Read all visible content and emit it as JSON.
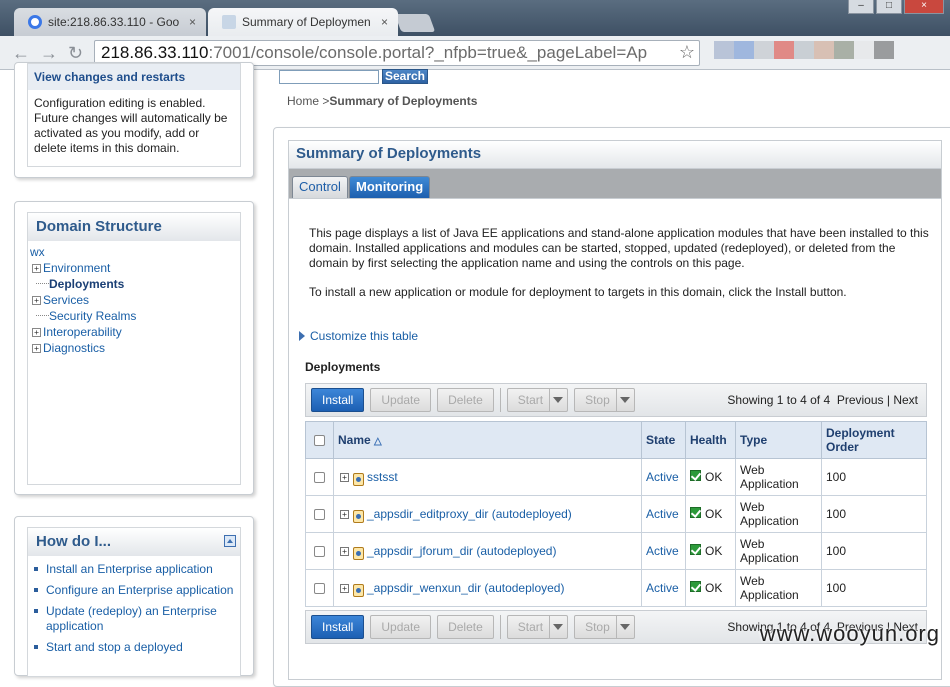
{
  "browser": {
    "tabs": [
      {
        "title": "site:218.86.33.110 - Goo",
        "close": "×",
        "favicon_color": "#3b78e7"
      },
      {
        "title": "Summary of Deploymen",
        "close": "×",
        "favicon_color": "#c8d6e6"
      }
    ],
    "address": {
      "host": "218.86.33.110",
      "path": ":7001/console/console.portal?_nfpb=true&_pageLabel=Ap"
    },
    "window_buttons": [
      "–",
      "□",
      "×"
    ]
  },
  "change_center": {
    "link": "View changes and restarts",
    "text": "Configuration editing is enabled. Future changes will automatically be activated as you modify, add or delete items in this domain."
  },
  "domain_structure": {
    "title": "Domain Structure",
    "root": "wx",
    "items": [
      {
        "label": "Environment",
        "expandable": true
      },
      {
        "label": "Deployments",
        "expandable": false,
        "selected": true
      },
      {
        "label": "Services",
        "expandable": true
      },
      {
        "label": "Security Realms",
        "expandable": false
      },
      {
        "label": "Interoperability",
        "expandable": true
      },
      {
        "label": "Diagnostics",
        "expandable": true
      }
    ]
  },
  "how_do_i": {
    "title": "How do I...",
    "items": [
      "Install an Enterprise application",
      "Configure an Enterprise application",
      "Update (redeploy) an Enterprise application",
      "Start and stop a deployed"
    ]
  },
  "search": {
    "button": "Search"
  },
  "breadcrumb": {
    "home": "Home",
    "sep": ">",
    "current": "Summary of Deployments"
  },
  "main": {
    "title": "Summary of Deployments",
    "tabs": [
      {
        "label": "Control"
      },
      {
        "label": "Monitoring"
      }
    ],
    "intro1": "This page displays a list of Java EE applications and stand-alone application modules that have been installed to this domain. Installed applications and modules can be started, stopped, updated (redeployed), or deleted from the domain by first selecting the application name and using the controls on this page.",
    "intro2": "To install a new application or module for deployment to targets in this domain, click the Install button.",
    "customize": "Customize this table",
    "table_label": "Deployments",
    "buttons": {
      "install": "Install",
      "update": "Update",
      "delete": "Delete",
      "start": "Start",
      "stop": "Stop"
    },
    "pager": {
      "showing": "Showing 1 to 4 of 4",
      "previous": "Previous",
      "sep": "|",
      "next": "Next"
    },
    "columns": [
      "Name",
      "State",
      "Health",
      "Type",
      "Deployment Order"
    ],
    "rows": [
      {
        "name": "sstsst",
        "state": "Active",
        "health": "OK",
        "type": "Web Application",
        "order": "100"
      },
      {
        "name": "_appsdir_editproxy_dir (autodeployed)",
        "state": "Active",
        "health": "OK",
        "type": "Web Application",
        "order": "100"
      },
      {
        "name": "_appsdir_jforum_dir (autodeployed)",
        "state": "Active",
        "health": "OK",
        "type": "Web Application",
        "order": "100"
      },
      {
        "name": "_appsdir_wenxun_dir (autodeployed)",
        "state": "Active",
        "health": "OK",
        "type": "Web Application",
        "order": "100"
      }
    ]
  },
  "watermark": "www.wooyun.org",
  "colors": {
    "accent": "#2f5b8c",
    "link": "#1a5fa6",
    "primary_button": "#1c5fb3",
    "header_row": "#dfe8f3"
  }
}
